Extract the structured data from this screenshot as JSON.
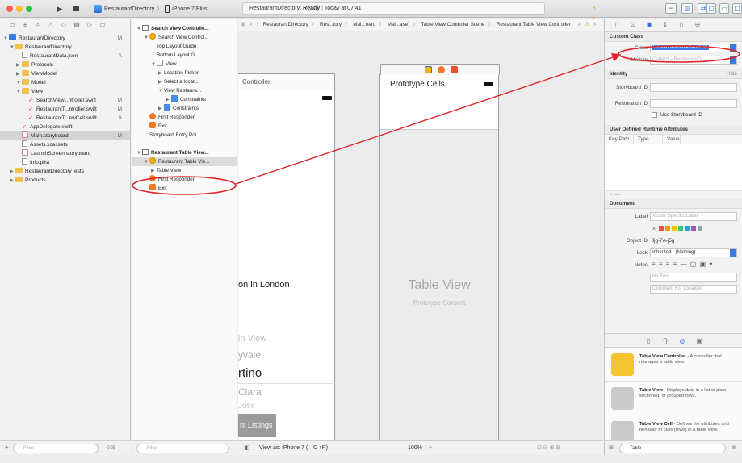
{
  "toolbar": {
    "scheme_target": "RestaurantDirectory",
    "scheme_device": "iPhone 7 Plus",
    "status_app": "RestaurantDirectory:",
    "status_state": "Ready",
    "status_time": "Today at 07:41",
    "warning_count": "2"
  },
  "navigator": {
    "items": [
      {
        "label": "RestaurantDirectory",
        "badge": "M",
        "indent": 0,
        "kind": "project",
        "open": true
      },
      {
        "label": "RestaurantDirectory",
        "badge": "",
        "indent": 1,
        "kind": "folder",
        "open": true
      },
      {
        "label": "RestaurantData.json",
        "badge": "A",
        "indent": 2,
        "kind": "file"
      },
      {
        "label": "Protocols",
        "badge": "",
        "indent": 2,
        "kind": "folder",
        "open": false
      },
      {
        "label": "ViewModel",
        "badge": "",
        "indent": 2,
        "kind": "folder",
        "open": false
      },
      {
        "label": "Model",
        "badge": "",
        "indent": 2,
        "kind": "folder",
        "open": true
      },
      {
        "label": "View",
        "badge": "",
        "indent": 2,
        "kind": "folder",
        "open": true
      },
      {
        "label": "SearchView...ntroller.swift",
        "badge": "M",
        "indent": 3,
        "kind": "swift"
      },
      {
        "label": "RestaurantT...ntroller.swift",
        "badge": "M",
        "indent": 3,
        "kind": "swift"
      },
      {
        "label": "RestaurantT...ewCell.swift",
        "badge": "A",
        "indent": 3,
        "kind": "swift"
      },
      {
        "label": "AppDelegate.swift",
        "badge": "",
        "indent": 2,
        "kind": "swift"
      },
      {
        "label": "Main.storyboard",
        "badge": "M",
        "indent": 2,
        "kind": "storyboard",
        "selected": true
      },
      {
        "label": "Assets.xcassets",
        "badge": "",
        "indent": 2,
        "kind": "file"
      },
      {
        "label": "LaunchScreen.storyboard",
        "badge": "",
        "indent": 2,
        "kind": "storyboard"
      },
      {
        "label": "Info.plist",
        "badge": "",
        "indent": 2,
        "kind": "file"
      },
      {
        "label": "RestaurantDirectoryTests",
        "badge": "",
        "indent": 1,
        "kind": "folder",
        "open": false
      },
      {
        "label": "Products",
        "badge": "",
        "indent": 1,
        "kind": "folder",
        "open": false
      }
    ],
    "filter_placeholder": "Filter"
  },
  "outline": {
    "items": [
      {
        "label": "Search View Controlle...",
        "indent": 0,
        "kind": "scene",
        "tri": "▼"
      },
      {
        "label": "Search View Control...",
        "indent": 1,
        "kind": "vc",
        "tri": "▼"
      },
      {
        "label": "Top Layout Guide",
        "indent": 2,
        "kind": "none",
        "tri": ""
      },
      {
        "label": "Bottom Layout G...",
        "indent": 2,
        "kind": "none",
        "tri": ""
      },
      {
        "label": "View",
        "indent": 2,
        "kind": "view",
        "tri": "▼"
      },
      {
        "label": "Location Picker",
        "indent": 3,
        "kind": "none",
        "tri": "▶"
      },
      {
        "label": "Select a locati...",
        "indent": 3,
        "kind": "none",
        "tri": "▶"
      },
      {
        "label": "View Restaura...",
        "indent": 3,
        "kind": "none",
        "tri": "▼"
      },
      {
        "label": "Constraints",
        "indent": 4,
        "kind": "blue",
        "tri": "▶"
      },
      {
        "label": "Constraints",
        "indent": 3,
        "kind": "blue",
        "tri": "▶"
      },
      {
        "label": "First Responder",
        "indent": 1,
        "kind": "orange",
        "tri": ""
      },
      {
        "label": "Exit",
        "indent": 1,
        "kind": "exit",
        "tri": ""
      },
      {
        "label": "Storyboard Entry Poi...",
        "indent": 1,
        "kind": "none",
        "tri": ""
      },
      {
        "label": "",
        "indent": 0,
        "kind": "gap",
        "tri": ""
      },
      {
        "label": "Restaurant Table View...",
        "indent": 0,
        "kind": "scene",
        "tri": "▼"
      },
      {
        "label": "Restaurant Table Vie...",
        "indent": 1,
        "kind": "vc",
        "tri": "▼",
        "selected": true
      },
      {
        "label": "Table View",
        "indent": 2,
        "kind": "none",
        "tri": "▶"
      },
      {
        "label": "First Responder",
        "indent": 1,
        "kind": "orange",
        "tri": ""
      },
      {
        "label": "Exit",
        "indent": 1,
        "kind": "exit",
        "tri": ""
      }
    ],
    "filter_placeholder": "Filter"
  },
  "jump_bar": [
    "RestaurantDirectory",
    "Res...tory",
    "Mai...oard",
    "Mai...ase)",
    "Table View Controller Scene",
    "Restaurant Table View Controller"
  ],
  "canvas": {
    "scene1": {
      "header": "Controller",
      "title": "on in London",
      "picker_items": [
        "in View",
        "yvale",
        "rtino",
        "Clara",
        "Jose"
      ],
      "button": "nt Listings"
    },
    "scene2": {
      "prototype_label": "Prototype Cells",
      "placeholder_title": "Table View",
      "placeholder_sub": "Prototype Content"
    },
    "footer": {
      "view_as": "View as: iPhone 7 (←C ↑R)",
      "zoom": "100%"
    }
  },
  "inspector": {
    "custom_class_header": "Custom Class",
    "class_label": "Class",
    "class_value": "RestaurantTableViewCon",
    "module_label": "Module",
    "module_placeholder": "Current – RestaurantD...",
    "identity_header": "Identity",
    "hide_label": "Hide",
    "storyboard_id_label": "Storyboard ID",
    "restoration_id_label": "Restoration ID",
    "use_storyboard_id": "Use Storyboard ID",
    "udra_header": "User Defined Runtime Attributes",
    "udra_cols": [
      "Key Path",
      "Type",
      "Value"
    ],
    "document_header": "Document",
    "doc_label_label": "Label",
    "doc_label_placeholder": "Xcode Specific Label",
    "object_id_label": "Object ID",
    "object_id_value": "Jjg-7A-j5g",
    "lock_label": "Lock",
    "lock_value": "Inherited - (Nothing)",
    "notes_label": "Notes",
    "no_font": "No Font",
    "comment_placeholder": "Comment For Localizer",
    "library": [
      {
        "title": "Table View Controller",
        "desc": " - A controller that manages a table view.",
        "color": "#f4c430"
      },
      {
        "title": "Table View",
        "desc": " - Displays data in a list of plain, sectioned, or grouped rows.",
        "color": "#c9c9c9"
      },
      {
        "title": "Table View Cell",
        "desc": " - Defines the attributes and behavior of cells (rows) in a table view.",
        "color": "#c9c9c9"
      }
    ],
    "library_filter": "Table"
  },
  "colors": {
    "accent": "#2a6fd6",
    "annotation": "#e0262b"
  }
}
